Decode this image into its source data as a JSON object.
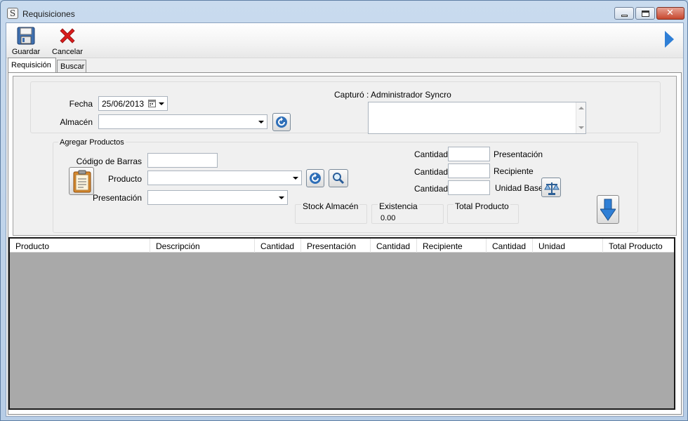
{
  "window": {
    "title": "Requisiciones",
    "app_icon": "S",
    "close_glyph": "✕"
  },
  "toolbar": {
    "save_label": "Guardar",
    "cancel_label": "Cancelar"
  },
  "tabs": [
    {
      "label": "Requisición",
      "active": true
    },
    {
      "label": "Buscar",
      "active": false
    }
  ],
  "header_form": {
    "fecha_label": "Fecha",
    "fecha_value": "25/06/2013",
    "almacen_label": "Almacén",
    "almacen_value": "",
    "capturo_text": "Capturó : Administrador Syncro",
    "notes_value": ""
  },
  "add_products": {
    "legend": "Agregar Productos",
    "barcode_label": "Código de Barras",
    "barcode_value": "",
    "producto_label": "Producto",
    "producto_value": "",
    "presentacion_label": "Presentación",
    "presentacion_value": "",
    "cantidad_label": "Cantidad",
    "qty_rows": [
      {
        "value": "",
        "unit_label": "Presentación"
      },
      {
        "value": "",
        "unit_label": "Recipiente"
      },
      {
        "value": "",
        "unit_label": "Unidad Base"
      }
    ],
    "stock_almacen_label": "Stock Almacén",
    "stock_almacen_value": "",
    "existencia_label": "Existencia",
    "existencia_value": "0.00",
    "total_producto_label": "Total Producto",
    "total_producto_value": ""
  },
  "grid": {
    "columns": [
      "Producto",
      "Descripción",
      "Cantidad",
      "Presentación",
      "Cantidad",
      "Recipiente",
      "Cantidad",
      "Unidad",
      "Total Producto"
    ],
    "rows": []
  },
  "colors": {
    "accent_blue": "#2f7fd6",
    "close_red": "#c6472e",
    "grid_empty": "#a9a9a9"
  }
}
